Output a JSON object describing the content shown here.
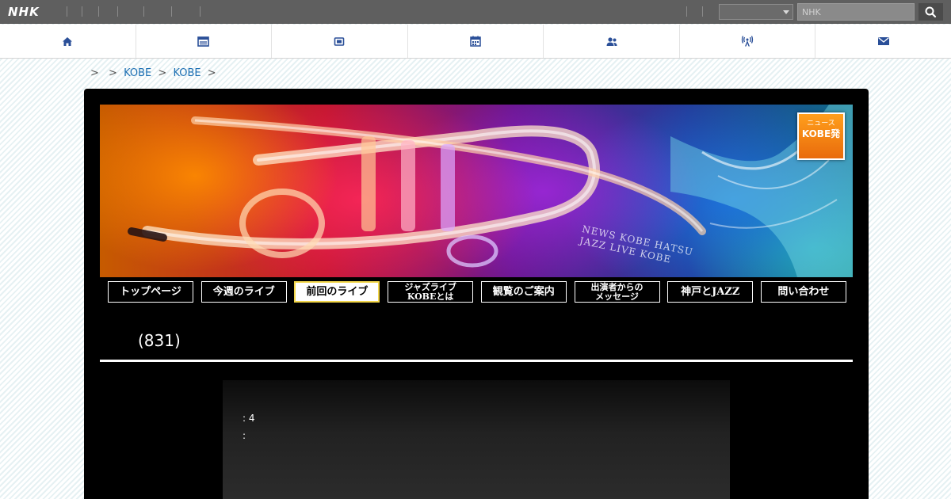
{
  "header": {
    "logo": "NHK",
    "search": {
      "placeholder": "NHK",
      "select_value": ""
    }
  },
  "nav": {
    "items": [
      {
        "icon": "home-icon"
      },
      {
        "icon": "program-guide-icon"
      },
      {
        "icon": "tv-icon"
      },
      {
        "icon": "calendar-icon"
      },
      {
        "icon": "people-icon"
      },
      {
        "icon": "broadcast-tower-icon"
      },
      {
        "icon": "mail-icon"
      }
    ]
  },
  "breadcrumb": {
    "items": [
      {
        "label": ">",
        "link": false
      },
      {
        "label": ">",
        "link": false
      },
      {
        "label": "KOBE",
        "link": true
      },
      {
        "label": ">",
        "link": false
      },
      {
        "label": "KOBE",
        "link": true
      },
      {
        "label": ">",
        "link": false
      }
    ]
  },
  "banner": {
    "logo_top": "ニュース",
    "logo_mid": "KOBE発",
    "overlay_line1": "NEWS KOBE HATSU",
    "overlay_line2": "JAZZ LIVE KOBE"
  },
  "menu": {
    "items": [
      {
        "label": "トップページ",
        "active": false
      },
      {
        "label": "今週のライブ",
        "active": false
      },
      {
        "label": "前回のライブ",
        "active": true
      },
      {
        "label": "ジャズライブ\nKOBEとは",
        "active": false
      },
      {
        "label": "観覧のご案内",
        "active": false
      },
      {
        "label": "出演者からの\nメッセージ",
        "active": false
      },
      {
        "label": "神戸とJAZZ",
        "active": false
      },
      {
        "label": "問い合わせ",
        "active": false
      }
    ]
  },
  "page": {
    "title": "(831)",
    "content_lines": [
      ": 4",
      ":"
    ]
  },
  "colors": {
    "topbar": "#5f5f5f",
    "link": "#1c6fb3",
    "panel": "#000000",
    "active_border": "#f2d64a"
  }
}
